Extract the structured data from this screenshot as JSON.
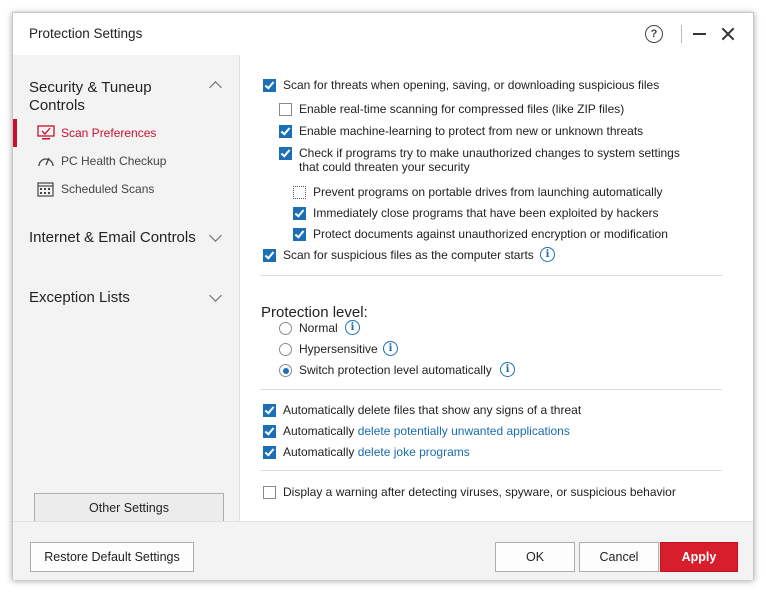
{
  "window": {
    "title": "Protection Settings",
    "help_icon": "?"
  },
  "sidebar": {
    "sections": [
      {
        "label": "Security & Tuneup Controls",
        "expanded": true
      },
      {
        "label": "Internet & Email Controls",
        "expanded": false
      },
      {
        "label": "Exception Lists",
        "expanded": false
      }
    ],
    "items": [
      {
        "label": "Scan Preferences",
        "icon": "monitor-scan-icon",
        "active": true
      },
      {
        "label": "PC Health Checkup",
        "icon": "gauge-icon",
        "active": false
      },
      {
        "label": "Scheduled Scans",
        "icon": "calendar-icon",
        "active": false
      }
    ],
    "other_settings_label": "Other Settings"
  },
  "options": {
    "scan_on_open": {
      "label": "Scan for threats when opening, saving, or downloading suspicious files",
      "checked": true
    },
    "compressed": {
      "label": "Enable real-time scanning for compressed files (like ZIP files)",
      "checked": false
    },
    "ml": {
      "label": "Enable machine-learning to protect from new or unknown threats",
      "checked": true
    },
    "unauthorized": {
      "label_line1": "Check if programs try to make unauthorized changes to system settings",
      "label_line2": "that could threaten your security",
      "checked": true
    },
    "portable": {
      "label": "Prevent programs on portable drives from launching automatically",
      "checked": false
    },
    "exploited": {
      "label": "Immediately close programs that have been exploited by hackers",
      "checked": true
    },
    "encryption": {
      "label": "Protect documents against unauthorized encryption or modification",
      "checked": true
    },
    "startup": {
      "label": "Scan for suspicious files as the computer starts",
      "checked": true
    }
  },
  "protection": {
    "heading": "Protection level:",
    "levels": [
      {
        "label": "Normal",
        "selected": false
      },
      {
        "label": "Hypersensitive",
        "selected": false
      },
      {
        "label": "Switch protection level automatically",
        "selected": true
      }
    ]
  },
  "auto": {
    "delete_threats": {
      "label": "Automatically delete files that show any signs of a threat",
      "checked": true
    },
    "pua": {
      "prefix": "Automatically ",
      "link": "delete potentially unwanted applications",
      "checked": true
    },
    "joke": {
      "prefix": "Automatically ",
      "link": "delete joke programs",
      "checked": true
    }
  },
  "warning": {
    "label": "Display a warning after detecting viruses, spyware, or suspicious behavior",
    "checked": false
  },
  "footer": {
    "restore": "Restore Default Settings",
    "ok": "OK",
    "cancel": "Cancel",
    "apply": "Apply"
  },
  "colors": {
    "accent": "#c8102e",
    "check": "#1c6fb5",
    "link": "#1a6bb0",
    "apply": "#d71e2d"
  }
}
